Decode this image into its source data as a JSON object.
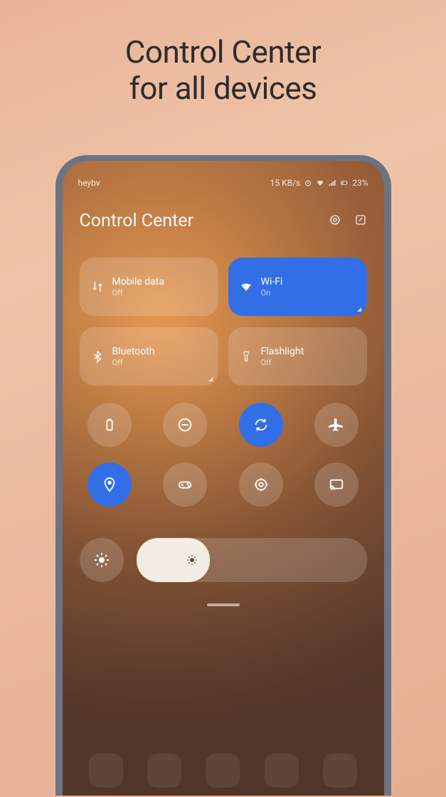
{
  "promo": {
    "headline_line1": "Control Center",
    "headline_line2": "for all devices"
  },
  "status_bar": {
    "carrier": "heybv",
    "speed": "15 KB/s",
    "battery_pct": "23%"
  },
  "header": {
    "title": "Control Center"
  },
  "tiles_large": [
    {
      "id": "mobile-data",
      "label": "Mobile data",
      "state": "Off",
      "active": false,
      "icon": "swap-icon",
      "expandable": false
    },
    {
      "id": "wifi",
      "label": "Wi-Fi",
      "state": "On",
      "active": true,
      "icon": "wifi-icon",
      "expandable": true
    },
    {
      "id": "bluetooth",
      "label": "Bluetooth",
      "state": "Off",
      "active": false,
      "icon": "bluetooth-icon",
      "expandable": true
    },
    {
      "id": "flashlight",
      "label": "Flashlight",
      "state": "Off",
      "active": false,
      "icon": "flashlight-icon",
      "expandable": false
    }
  ],
  "tiles_round": [
    {
      "id": "battery-saver",
      "icon": "battery-icon",
      "active": false
    },
    {
      "id": "dnd",
      "icon": "dnd-icon",
      "active": false
    },
    {
      "id": "auto-rotate",
      "icon": "rotate-icon",
      "active": true
    },
    {
      "id": "airplane",
      "icon": "airplane-icon",
      "active": false
    },
    {
      "id": "location",
      "icon": "location-icon",
      "active": true
    },
    {
      "id": "game-mode",
      "icon": "gamepad-icon",
      "active": false
    },
    {
      "id": "focus",
      "icon": "target-icon",
      "active": false
    },
    {
      "id": "cast",
      "icon": "cast-icon",
      "active": false
    }
  ],
  "brightness": {
    "value_pct": 32
  },
  "colors": {
    "accent": "#2f6fed",
    "tile_off": "rgba(255,255,255,0.17)"
  }
}
